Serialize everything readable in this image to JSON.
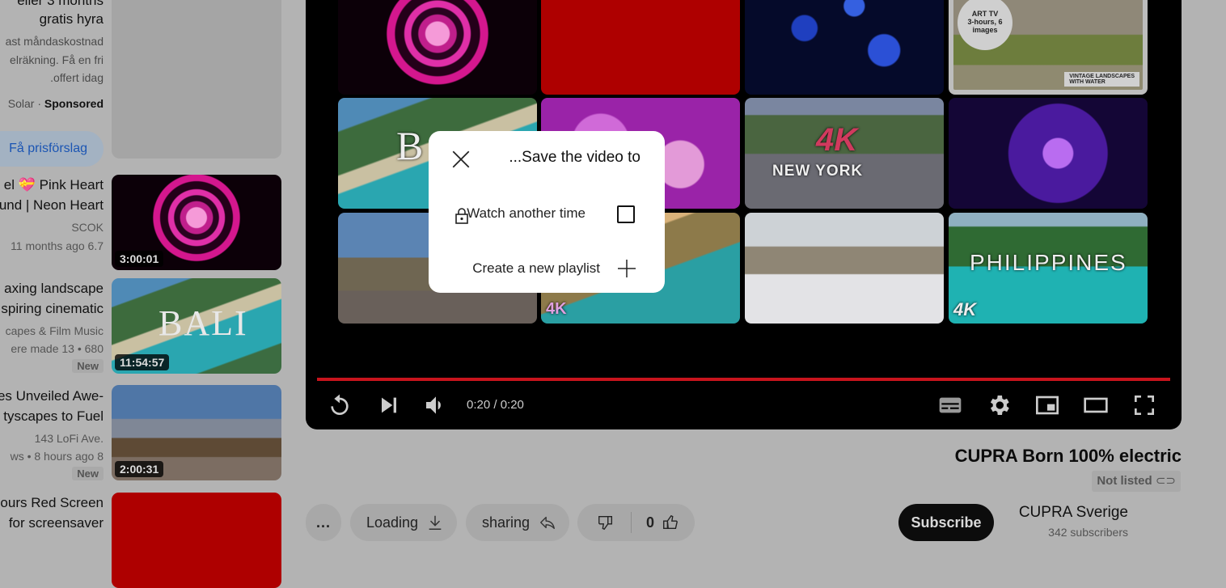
{
  "sidebar": {
    "ad": {
      "title_line1": "eller  3 months",
      "title_line2": "gratis hyra",
      "desc_lines": [
        "ast måndaskostnad",
        "elräkning. Få en fri",
        ".offert idag"
      ],
      "advertiser": "Solar",
      "separator": "·",
      "sponsored": "Sponsored",
      "cta": "Få prisförslag"
    },
    "videos": [
      {
        "title_lines": [
          "el 💝 Pink Heart",
          "und | Neon Heart"
        ],
        "channel": "SCOK",
        "meta": "11 months ago 6.7",
        "badge": "",
        "duration": "3:00:01"
      },
      {
        "title_lines": [
          "axing landscape",
          "spiring cinematic"
        ],
        "channel": "capes & Film Music",
        "meta": "ere made 13 •  680",
        "badge": "New",
        "duration": "11:54:57"
      },
      {
        "title_lines": [
          "es Unveiled Awe-",
          "tyscapes to Fuel"
        ],
        "channel": "143 LoFi Ave.",
        "meta": "ws  • 8 hours ago 8",
        "badge": "New",
        "duration": "2:00:31"
      },
      {
        "title_lines": [
          "ours Red Screen",
          "for screensaver"
        ],
        "channel": "",
        "meta": "",
        "badge": "",
        "duration": ""
      }
    ]
  },
  "player": {
    "grid": [
      {
        "label": "",
        "art": "heart"
      },
      {
        "label": "",
        "art": "red"
      },
      {
        "label": "",
        "art": "stars"
      },
      {
        "label": "ART TV · 3-hours, 6 images · VINTAGE LANDSCAPES WITH WATER",
        "art": "arttv"
      },
      {
        "label": "B",
        "art": "bali"
      },
      {
        "label": "",
        "art": "wave"
      },
      {
        "label": "4K NEW YORK",
        "art": "ny"
      },
      {
        "label": "",
        "art": "tunnel"
      },
      {
        "label": "",
        "art": "la"
      },
      {
        "label": "4K",
        "art": "beach"
      },
      {
        "label": "",
        "art": "snow"
      },
      {
        "label": "PHILIPPINES",
        "art": "phil"
      }
    ],
    "progress_fraction": 1.0,
    "time_display": "0:20 / 0:20",
    "controls_left": [
      "replay-icon",
      "next-icon",
      "volume-icon"
    ],
    "controls_right": [
      "subtitles-icon",
      "settings-icon",
      "miniplayer-icon",
      "theater-mode-icon",
      "fullscreen-icon"
    ],
    "accent_color": "#c8141d"
  },
  "dialog": {
    "title": "...Save the video to",
    "playlists": [
      {
        "label": "Watch another time",
        "privacy_icon": "lock-icon",
        "checked": false
      }
    ],
    "create_label": "Create a new playlist"
  },
  "video": {
    "title": "CUPRA Born 100% electric",
    "visibility": "Not listed",
    "channel": "CUPRA Sverige",
    "subscribers": "342 subscribers",
    "subscribe_label": "Subscribe",
    "actions": {
      "more_label": "...",
      "download_label": "Loading",
      "share_label": "sharing",
      "like_count": "0"
    }
  }
}
